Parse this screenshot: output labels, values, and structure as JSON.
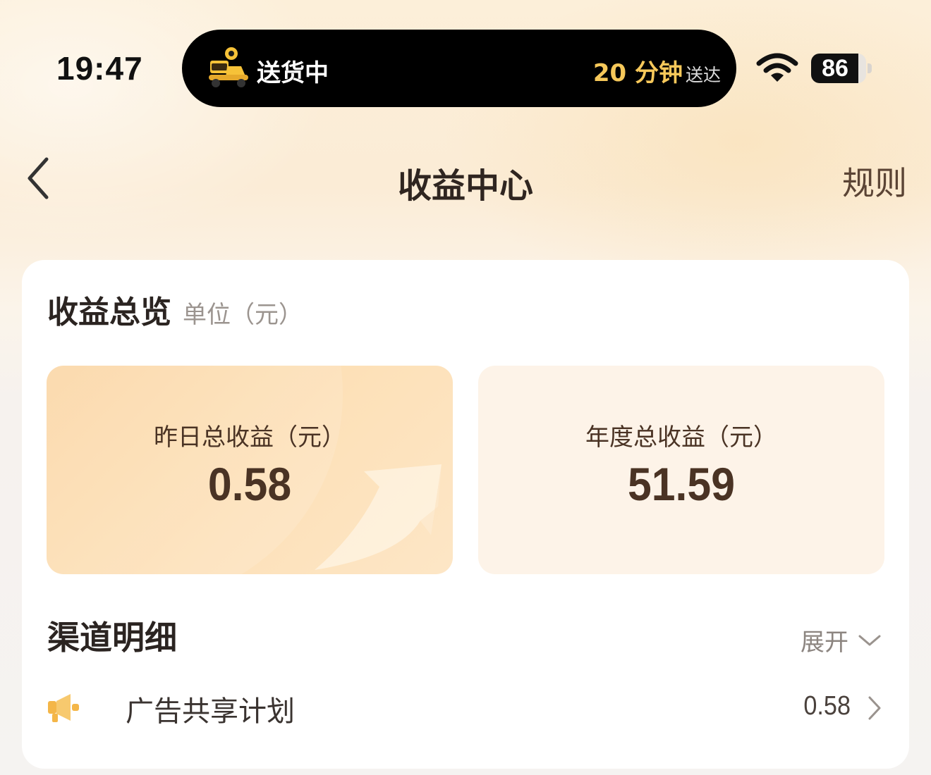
{
  "status_bar": {
    "time": "19:47",
    "battery_level": 86,
    "battery_label": "86",
    "wifi_icon": "wifi-icon"
  },
  "live_activity": {
    "icon": "delivery-scooter-icon",
    "status": "送货中",
    "eta": "20 分钟",
    "eta_suffix": "送达"
  },
  "nav": {
    "back_icon": "chevron-left-icon",
    "title": "收益中心",
    "rules": "规则"
  },
  "overview": {
    "title": "收益总览",
    "unit": "单位（元）",
    "yesterday": {
      "label": "昨日总收益（元）",
      "value": "0.58"
    },
    "yearly": {
      "label": "年度总收益（元）",
      "value": "51.59"
    }
  },
  "channels": {
    "title": "渠道明细",
    "expand_label": "展开",
    "items": [
      {
        "icon": "megaphone-icon",
        "name": "广告共享计划",
        "value": "0.58"
      }
    ]
  },
  "colors": {
    "accent": "#f6c85a",
    "value_brown": "#4a3324",
    "yesterday_card": "#fbd6a4",
    "yearly_card": "#fdf3e8"
  }
}
